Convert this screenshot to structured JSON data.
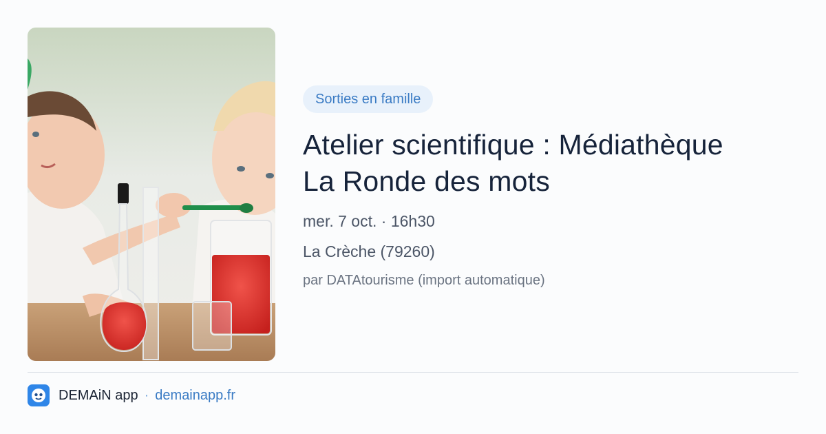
{
  "event": {
    "category": "Sorties en famille",
    "title_line1": "Atelier scientifique : Médiathèque",
    "title_line2": "La Ronde des mots",
    "datetime": "mer. 7 oct. · 16h30",
    "location": "La Crèche (79260)",
    "source": "par DATAtourisme (import automatique)",
    "image_alt": "Children doing a science experiment with red liquid in laboratory glassware"
  },
  "footer": {
    "app_name": "DEMAiN app",
    "separator": "·",
    "domain": "demainapp.fr"
  },
  "colors": {
    "accent": "#3a7bc4",
    "badge_bg": "#e8f1fb",
    "title": "#16233a",
    "logo_bg": "#2f86e8"
  },
  "icons": {
    "app_logo": "demain-app-logo-icon"
  }
}
